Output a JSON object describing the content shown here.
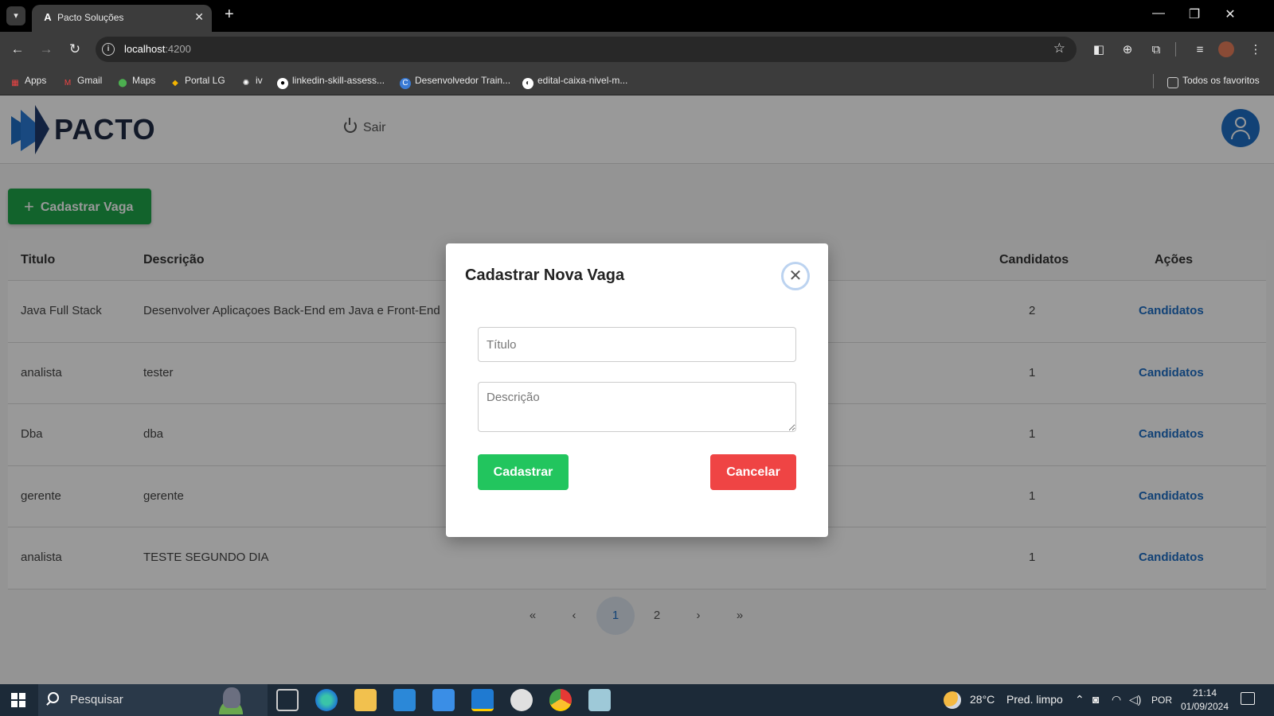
{
  "browser": {
    "tab_title": "Pacto Soluções",
    "url_host": "localhost",
    "url_port": ":4200",
    "bookmarks": [
      "Apps",
      "Gmail",
      "Maps",
      "Portal LG",
      "iv",
      "linkedin-skill-assess...",
      "Desenvolvedor Train...",
      "edital-caixa-nivel-m..."
    ],
    "all_bookmarks": "Todos os favoritos"
  },
  "app": {
    "logo_text": "PACTO",
    "logout_label": "Sair",
    "add_button_label": "Cadastrar Vaga",
    "brand_color": "#1f6fc5"
  },
  "table": {
    "headers": {
      "titulo": "Titulo",
      "descricao": "Descrição",
      "candidatos": "Candidatos",
      "acoes": "Ações"
    },
    "rows": [
      {
        "titulo": "Java Full Stack",
        "descricao": "Desenvolver Aplicaçoes Back-End em Java e Front-End",
        "candidatos": "2",
        "acao": "Candidatos"
      },
      {
        "titulo": "analista",
        "descricao": "tester",
        "candidatos": "1",
        "acao": "Candidatos"
      },
      {
        "titulo": "Dba",
        "descricao": "dba",
        "candidatos": "1",
        "acao": "Candidatos"
      },
      {
        "titulo": "gerente",
        "descricao": "gerente",
        "candidatos": "1",
        "acao": "Candidatos"
      },
      {
        "titulo": "analista",
        "descricao": "TESTE SEGUNDO DIA",
        "candidatos": "1",
        "acao": "Candidatos"
      }
    ]
  },
  "pagination": {
    "first": "«",
    "prev": "‹",
    "pages": [
      "1",
      "2"
    ],
    "current": "1",
    "next": "›",
    "last": "»"
  },
  "modal": {
    "title": "Cadastrar Nova Vaga",
    "titulo_placeholder": "Título",
    "descricao_placeholder": "Descrição",
    "submit_label": "Cadastrar",
    "cancel_label": "Cancelar"
  },
  "taskbar": {
    "search_placeholder": "Pesquisar",
    "temperature": "28°C",
    "weather": "Pred. limpo",
    "language": "POR",
    "time": "21:14",
    "date": "01/09/2024"
  }
}
